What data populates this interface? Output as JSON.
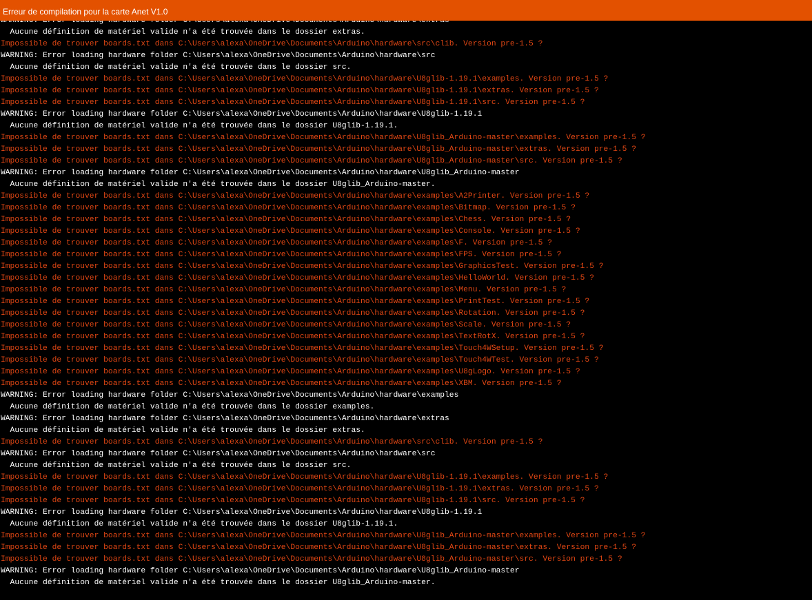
{
  "window": {
    "title": "Erreur de compilation pour la carte Anet V1.0"
  },
  "colors": {
    "header_bg": "#e35100",
    "console_bg": "#000000",
    "warning_text": "#ffffff",
    "error_text": "#e24714"
  },
  "console": {
    "lines": [
      {
        "type": "warning",
        "text": "WARNING: Error loading hardware folder C:\\Users\\alexa\\OneDrive\\Documents\\Arduino\\hardware\\extras"
      },
      {
        "type": "info",
        "text": "  Aucune définition de matériel valide n'a été trouvée dans le dossier extras."
      },
      {
        "type": "error",
        "text": "Impossible de trouver boards.txt dans C:\\Users\\alexa\\OneDrive\\Documents\\Arduino\\hardware\\src\\clib. Version pre-1.5 ?"
      },
      {
        "type": "warning",
        "text": "WARNING: Error loading hardware folder C:\\Users\\alexa\\OneDrive\\Documents\\Arduino\\hardware\\src"
      },
      {
        "type": "info",
        "text": "  Aucune définition de matériel valide n'a été trouvée dans le dossier src."
      },
      {
        "type": "error",
        "text": "Impossible de trouver boards.txt dans C:\\Users\\alexa\\OneDrive\\Documents\\Arduino\\hardware\\U8glib-1.19.1\\examples. Version pre-1.5 ?"
      },
      {
        "type": "error",
        "text": "Impossible de trouver boards.txt dans C:\\Users\\alexa\\OneDrive\\Documents\\Arduino\\hardware\\U8glib-1.19.1\\extras. Version pre-1.5 ?"
      },
      {
        "type": "error",
        "text": "Impossible de trouver boards.txt dans C:\\Users\\alexa\\OneDrive\\Documents\\Arduino\\hardware\\U8glib-1.19.1\\src. Version pre-1.5 ?"
      },
      {
        "type": "warning",
        "text": "WARNING: Error loading hardware folder C:\\Users\\alexa\\OneDrive\\Documents\\Arduino\\hardware\\U8glib-1.19.1"
      },
      {
        "type": "info",
        "text": "  Aucune définition de matériel valide n'a été trouvée dans le dossier U8glib-1.19.1."
      },
      {
        "type": "error",
        "text": "Impossible de trouver boards.txt dans C:\\Users\\alexa\\OneDrive\\Documents\\Arduino\\hardware\\U8glib_Arduino-master\\examples. Version pre-1.5 ?"
      },
      {
        "type": "error",
        "text": "Impossible de trouver boards.txt dans C:\\Users\\alexa\\OneDrive\\Documents\\Arduino\\hardware\\U8glib_Arduino-master\\extras. Version pre-1.5 ?"
      },
      {
        "type": "error",
        "text": "Impossible de trouver boards.txt dans C:\\Users\\alexa\\OneDrive\\Documents\\Arduino\\hardware\\U8glib_Arduino-master\\src. Version pre-1.5 ?"
      },
      {
        "type": "warning",
        "text": "WARNING: Error loading hardware folder C:\\Users\\alexa\\OneDrive\\Documents\\Arduino\\hardware\\U8glib_Arduino-master"
      },
      {
        "type": "info",
        "text": "  Aucune définition de matériel valide n'a été trouvée dans le dossier U8glib_Arduino-master."
      },
      {
        "type": "error",
        "text": "Impossible de trouver boards.txt dans C:\\Users\\alexa\\OneDrive\\Documents\\Arduino\\hardware\\examples\\A2Printer. Version pre-1.5 ?"
      },
      {
        "type": "error",
        "text": "Impossible de trouver boards.txt dans C:\\Users\\alexa\\OneDrive\\Documents\\Arduino\\hardware\\examples\\Bitmap. Version pre-1.5 ?"
      },
      {
        "type": "error",
        "text": "Impossible de trouver boards.txt dans C:\\Users\\alexa\\OneDrive\\Documents\\Arduino\\hardware\\examples\\Chess. Version pre-1.5 ?"
      },
      {
        "type": "error",
        "text": "Impossible de trouver boards.txt dans C:\\Users\\alexa\\OneDrive\\Documents\\Arduino\\hardware\\examples\\Console. Version pre-1.5 ?"
      },
      {
        "type": "error",
        "text": "Impossible de trouver boards.txt dans C:\\Users\\alexa\\OneDrive\\Documents\\Arduino\\hardware\\examples\\F. Version pre-1.5 ?"
      },
      {
        "type": "error",
        "text": "Impossible de trouver boards.txt dans C:\\Users\\alexa\\OneDrive\\Documents\\Arduino\\hardware\\examples\\FPS. Version pre-1.5 ?"
      },
      {
        "type": "error",
        "text": "Impossible de trouver boards.txt dans C:\\Users\\alexa\\OneDrive\\Documents\\Arduino\\hardware\\examples\\GraphicsTest. Version pre-1.5 ?"
      },
      {
        "type": "error",
        "text": "Impossible de trouver boards.txt dans C:\\Users\\alexa\\OneDrive\\Documents\\Arduino\\hardware\\examples\\HelloWorld. Version pre-1.5 ?"
      },
      {
        "type": "error",
        "text": "Impossible de trouver boards.txt dans C:\\Users\\alexa\\OneDrive\\Documents\\Arduino\\hardware\\examples\\Menu. Version pre-1.5 ?"
      },
      {
        "type": "error",
        "text": "Impossible de trouver boards.txt dans C:\\Users\\alexa\\OneDrive\\Documents\\Arduino\\hardware\\examples\\PrintTest. Version pre-1.5 ?"
      },
      {
        "type": "error",
        "text": "Impossible de trouver boards.txt dans C:\\Users\\alexa\\OneDrive\\Documents\\Arduino\\hardware\\examples\\Rotation. Version pre-1.5 ?"
      },
      {
        "type": "error",
        "text": "Impossible de trouver boards.txt dans C:\\Users\\alexa\\OneDrive\\Documents\\Arduino\\hardware\\examples\\Scale. Version pre-1.5 ?"
      },
      {
        "type": "error",
        "text": "Impossible de trouver boards.txt dans C:\\Users\\alexa\\OneDrive\\Documents\\Arduino\\hardware\\examples\\TextRotX. Version pre-1.5 ?"
      },
      {
        "type": "error",
        "text": "Impossible de trouver boards.txt dans C:\\Users\\alexa\\OneDrive\\Documents\\Arduino\\hardware\\examples\\Touch4WSetup. Version pre-1.5 ?"
      },
      {
        "type": "error",
        "text": "Impossible de trouver boards.txt dans C:\\Users\\alexa\\OneDrive\\Documents\\Arduino\\hardware\\examples\\Touch4WTest. Version pre-1.5 ?"
      },
      {
        "type": "error",
        "text": "Impossible de trouver boards.txt dans C:\\Users\\alexa\\OneDrive\\Documents\\Arduino\\hardware\\examples\\U8gLogo. Version pre-1.5 ?"
      },
      {
        "type": "error",
        "text": "Impossible de trouver boards.txt dans C:\\Users\\alexa\\OneDrive\\Documents\\Arduino\\hardware\\examples\\XBM. Version pre-1.5 ?"
      },
      {
        "type": "warning",
        "text": "WARNING: Error loading hardware folder C:\\Users\\alexa\\OneDrive\\Documents\\Arduino\\hardware\\examples"
      },
      {
        "type": "info",
        "text": "  Aucune définition de matériel valide n'a été trouvée dans le dossier examples."
      },
      {
        "type": "warning",
        "text": "WARNING: Error loading hardware folder C:\\Users\\alexa\\OneDrive\\Documents\\Arduino\\hardware\\extras"
      },
      {
        "type": "info",
        "text": "  Aucune définition de matériel valide n'a été trouvée dans le dossier extras."
      },
      {
        "type": "error",
        "text": "Impossible de trouver boards.txt dans C:\\Users\\alexa\\OneDrive\\Documents\\Arduino\\hardware\\src\\clib. Version pre-1.5 ?"
      },
      {
        "type": "warning",
        "text": "WARNING: Error loading hardware folder C:\\Users\\alexa\\OneDrive\\Documents\\Arduino\\hardware\\src"
      },
      {
        "type": "info",
        "text": "  Aucune définition de matériel valide n'a été trouvée dans le dossier src."
      },
      {
        "type": "error",
        "text": "Impossible de trouver boards.txt dans C:\\Users\\alexa\\OneDrive\\Documents\\Arduino\\hardware\\U8glib-1.19.1\\examples. Version pre-1.5 ?"
      },
      {
        "type": "error",
        "text": "Impossible de trouver boards.txt dans C:\\Users\\alexa\\OneDrive\\Documents\\Arduino\\hardware\\U8glib-1.19.1\\extras. Version pre-1.5 ?"
      },
      {
        "type": "error",
        "text": "Impossible de trouver boards.txt dans C:\\Users\\alexa\\OneDrive\\Documents\\Arduino\\hardware\\U8glib-1.19.1\\src. Version pre-1.5 ?"
      },
      {
        "type": "warning",
        "text": "WARNING: Error loading hardware folder C:\\Users\\alexa\\OneDrive\\Documents\\Arduino\\hardware\\U8glib-1.19.1"
      },
      {
        "type": "info",
        "text": "  Aucune définition de matériel valide n'a été trouvée dans le dossier U8glib-1.19.1."
      },
      {
        "type": "error",
        "text": "Impossible de trouver boards.txt dans C:\\Users\\alexa\\OneDrive\\Documents\\Arduino\\hardware\\U8glib_Arduino-master\\examples. Version pre-1.5 ?"
      },
      {
        "type": "error",
        "text": "Impossible de trouver boards.txt dans C:\\Users\\alexa\\OneDrive\\Documents\\Arduino\\hardware\\U8glib_Arduino-master\\extras. Version pre-1.5 ?"
      },
      {
        "type": "error",
        "text": "Impossible de trouver boards.txt dans C:\\Users\\alexa\\OneDrive\\Documents\\Arduino\\hardware\\U8glib_Arduino-master\\src. Version pre-1.5 ?"
      },
      {
        "type": "warning",
        "text": "WARNING: Error loading hardware folder C:\\Users\\alexa\\OneDrive\\Documents\\Arduino\\hardware\\U8glib_Arduino-master"
      },
      {
        "type": "info",
        "text": "  Aucune définition de matériel valide n'a été trouvée dans le dossier U8glib_Arduino-master."
      }
    ]
  }
}
